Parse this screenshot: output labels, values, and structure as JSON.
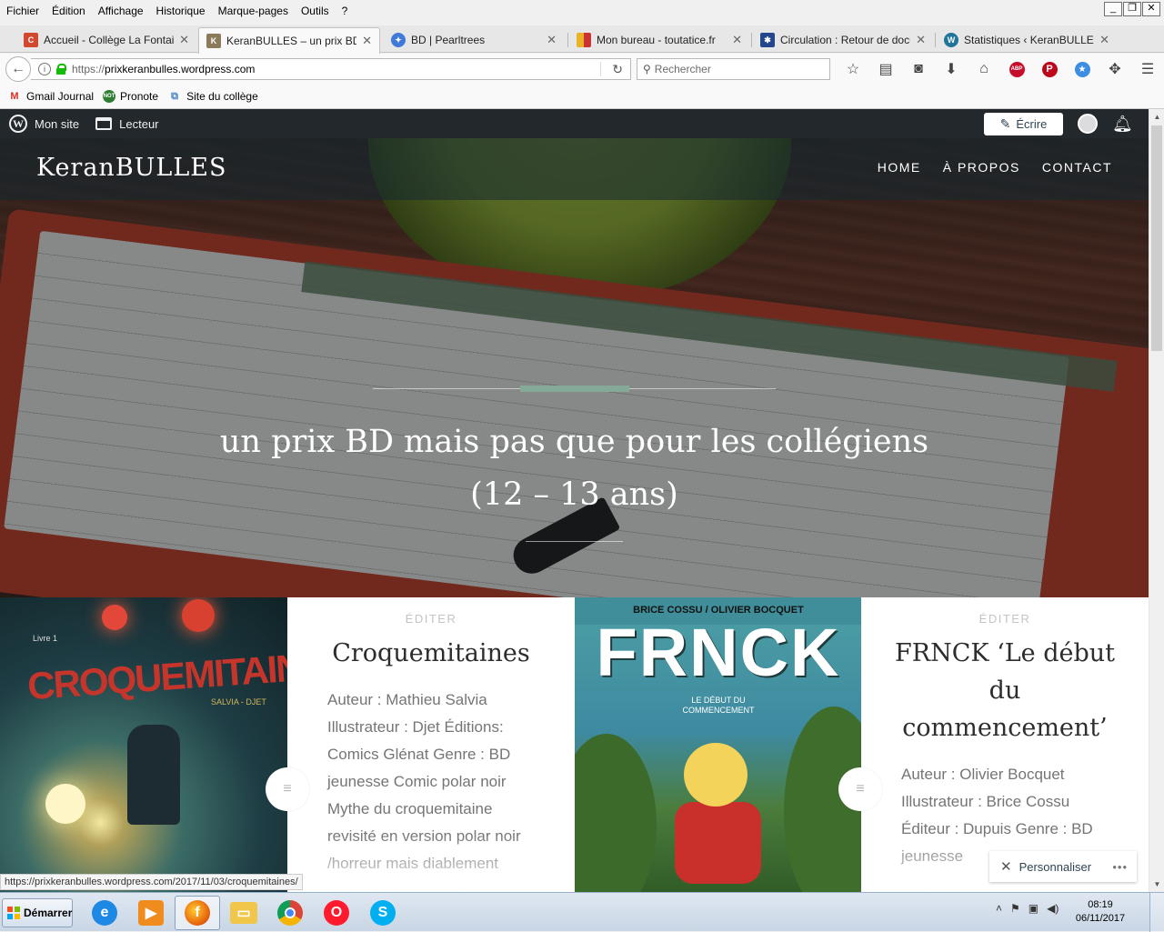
{
  "menubar": {
    "items": [
      "Fichier",
      "Édition",
      "Affichage",
      "Historique",
      "Marque-pages",
      "Outils",
      "?"
    ],
    "window_buttons": [
      "_",
      "❐",
      "✕"
    ]
  },
  "tabs": [
    {
      "label": "Accueil - Collège La Fontaine",
      "icon": "college-icon",
      "color": "#d1492e",
      "active": false
    },
    {
      "label": "KeranBULLES – un prix BD mais",
      "icon": "keranbulles-icon",
      "color": "#8b7b5a",
      "active": true
    },
    {
      "label": "BD | Pearltrees",
      "icon": "pearltrees-icon",
      "color": "#3f7ad8",
      "active": false
    },
    {
      "label": "Mon bureau - toutatice.fr",
      "icon": "toutatice-icon",
      "color": "#e9b22a",
      "active": false
    },
    {
      "label": "Circulation : Retour de documents",
      "icon": "circulation-icon",
      "color": "#23468c",
      "active": false
    },
    {
      "label": "Statistiques ‹ KeranBULLES — WordPress",
      "icon": "wordpress-icon",
      "color": "#21759b",
      "active": false
    }
  ],
  "navbar": {
    "url_proto": "https://",
    "url_host": "prixkeranbulles.wordpress.com",
    "search_placeholder": "Rechercher"
  },
  "bookmarks": [
    {
      "label": "Gmail Journal",
      "icon": "gmail-icon"
    },
    {
      "label": "Pronote",
      "icon": "pronote-icon"
    },
    {
      "label": "Site du collège",
      "icon": "site-icon"
    }
  ],
  "adminbar": {
    "my_site": "Mon site",
    "reader": "Lecteur",
    "write": "Écrire"
  },
  "site": {
    "title": "KeranBULLES",
    "nav": [
      "HOME",
      "À PROPOS",
      "CONTACT"
    ],
    "tagline_line1": "un prix BD mais pas que pour les collégiens",
    "tagline_line2": "(12 – 13 ans)"
  },
  "posts": [
    {
      "edit": "ÉDITER",
      "title": "Croquemitaines",
      "excerpt": "Auteur : Mathieu Salvia   Illustrateur : Djet     Éditions: Comics Glénat Genre : BD jeunesse Comic polar noir Mythe du croquemitaine revisité en version polar noir /horreur mais diablement",
      "cover": {
        "livre": "Livre 1",
        "title": "CROQUEMITAINES",
        "authors": "SALVIA - DJET"
      }
    },
    {
      "edit": "ÉDITER",
      "title": "FRNCK ‘Le début du commencement’",
      "excerpt": "Auteur :   Olivier Bocquet      Illustrateur :  Brice Cossu       Éditeur : Dupuis Genre : BD jeunesse",
      "cover": {
        "authors": "BRICE COSSU / OLIVIER BOCQUET",
        "title": "FRNCK",
        "subtitle_1": "LE DÉBUT DU",
        "subtitle_2": "COMMENCEMENT"
      }
    }
  ],
  "customize": {
    "label": "Personnaliser"
  },
  "status_url": "https://prixkeranbulles.wordpress.com/2017/11/03/croquemitaines/",
  "taskbar": {
    "start": "Démarrer",
    "apps": [
      "internet-explorer-icon",
      "media-player-icon",
      "firefox-icon",
      "file-explorer-icon",
      "chrome-icon",
      "opera-icon",
      "skype-icon"
    ],
    "time": "08:19",
    "date": "06/11/2017"
  },
  "colors": {
    "admin_bar": "#23282d",
    "accent_line": "#86a897",
    "title_text": "#2d2d2d",
    "excerpt_text": "#757575"
  }
}
